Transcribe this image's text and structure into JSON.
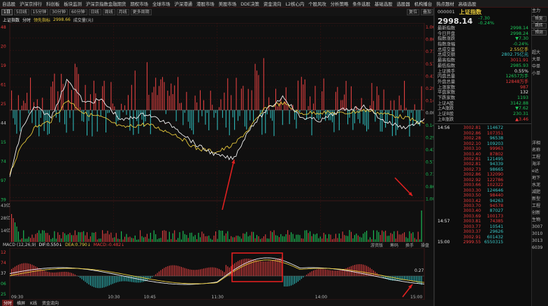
{
  "topnav": [
    "自选股",
    "沪深京排行",
    "科创板",
    "板块监测",
    "沪深京指数金融期货",
    "期权市场",
    "全球市场",
    "沪深港通",
    "港股市场",
    "美股市场",
    "DDE决策",
    "资金流向",
    "L2核心内",
    "个股风攻",
    "分析策略",
    "条件选股",
    "基础选股",
    "选股器",
    "机构播台",
    "热点题材",
    "高级选股"
  ],
  "toolbar": {
    "periods": [
      "1日",
      "5日线",
      "15分钟",
      "30分钟",
      "60分钟",
      "日线",
      "周线",
      "月线",
      "更多周期"
    ],
    "right": [
      "复位",
      "叠加"
    ]
  },
  "chartinfo": {
    "name": "上证指数",
    "period": "分时",
    "index_label": "领先指标",
    "index_value": "2998.66",
    "volume_label": "成交量(元)"
  },
  "left_axis": [
    "48",
    "20",
    "19",
    "61",
    "25",
    "44",
    "15",
    "74",
    "97",
    "39"
  ],
  "vol_axis": [
    "43亿",
    "28亿",
    "14亿"
  ],
  "macd_axis": [
    "12",
    "74",
    "37",
    "06",
    "25"
  ],
  "right_axis": [
    "1.06%",
    "0.86%",
    "0.71%",
    "0.57%",
    "0.43%",
    "0.29%",
    "0.14%",
    "0.00%",
    "0.14%",
    "0.29%",
    "0.43%",
    "0.57%",
    "0.71%",
    "0.86%",
    "1.00%"
  ],
  "macd": {
    "label": "MACD (12,26,9)",
    "dif": "DIF:0.550↓",
    "dea": "DEA:0.790↓",
    "macd": "MACD:-0.482↓",
    "tabs": [
      "游资版",
      "筹码",
      "换手",
      "操盘"
    ],
    "axis_value": "0.27"
  },
  "time_labels": [
    "09:30",
    "10:30",
    "10:45",
    "11:30",
    "14:00",
    "15:00"
  ],
  "bottombar": [
    "分时",
    "横屏",
    "K线",
    "资金流向"
  ],
  "quote": {
    "code": "000001",
    "name": "上证指数",
    "price": "2998.14",
    "change": "-7.30",
    "change_pct": "-0.24%",
    "rows": [
      {
        "k": "最新指数",
        "v": "2998.14",
        "c": "green"
      },
      {
        "k": "今日开盘",
        "v": "2998.24",
        "c": "green"
      },
      {
        "k": "指数涨跌",
        "v": "▼7.30",
        "c": "green"
      },
      {
        "k": "指数涨幅",
        "v": "-0.24%",
        "c": "green"
      },
      {
        "k": "总成交量",
        "v": "2.55亿手",
        "c": "yellow"
      },
      {
        "k": "总成交额",
        "v": "2802.75亿元",
        "c": "cyan"
      },
      {
        "k": "最高指数",
        "v": "3011.91",
        "c": "red"
      },
      {
        "k": "最低指数",
        "v": "2985.93",
        "c": "green"
      },
      {
        "k": "上证换手",
        "v": "0.55%",
        "c": "white"
      },
      {
        "k": "内盘总量",
        "v": "12657万手",
        "c": "green"
      },
      {
        "k": "外盘总量",
        "v": "12848万手",
        "c": "red"
      },
      {
        "k": "上涨家数",
        "v": "987",
        "c": "red"
      },
      {
        "k": "平盘家数",
        "v": "132",
        "c": "white"
      },
      {
        "k": "下跌家数",
        "v": "1193",
        "c": "green"
      },
      {
        "k": "上证A股",
        "v": "3142.88",
        "c": "green"
      },
      {
        "k": "上A涨跌",
        "v": "▼7.62",
        "c": "green"
      },
      {
        "k": "上证B股",
        "v": "230.31",
        "c": "green"
      },
      {
        "k": "上B涨跌",
        "v": "▲3.46",
        "c": "red"
      }
    ],
    "ticks": [
      {
        "t": "14:56",
        "p": "3002.81",
        "v": "114672",
        "d": "cyan"
      },
      {
        "t": "",
        "p": "3002.86",
        "v": "107351",
        "d": "red"
      },
      {
        "t": "",
        "p": "3002.28",
        "v": "96538",
        "d": "cyan"
      },
      {
        "t": "",
        "p": "3002.10",
        "v": "109203",
        "d": "cyan"
      },
      {
        "t": "",
        "p": "3003.10",
        "v": "99963",
        "d": "red"
      },
      {
        "t": "",
        "p": "3003.40",
        "v": "87802",
        "d": "red"
      },
      {
        "t": "",
        "p": "3002.81",
        "v": "121495",
        "d": "cyan"
      },
      {
        "t": "",
        "p": "3002.81",
        "v": "94339",
        "d": "cyan"
      },
      {
        "t": "",
        "p": "3002.73",
        "v": "98665",
        "d": "cyan"
      },
      {
        "t": "",
        "p": "3002.86",
        "v": "132090",
        "d": "red"
      },
      {
        "t": "",
        "p": "3002.92",
        "v": "122786",
        "d": "red"
      },
      {
        "t": "",
        "p": "3003.66",
        "v": "102322",
        "d": "red"
      },
      {
        "t": "",
        "p": "3003.30",
        "v": "124646",
        "d": "cyan"
      },
      {
        "t": "",
        "p": "3003.50",
        "v": "98440",
        "d": "red"
      },
      {
        "t": "",
        "p": "3003.42",
        "v": "94263",
        "d": "cyan"
      },
      {
        "t": "",
        "p": "3003.70",
        "v": "94578",
        "d": "red"
      },
      {
        "t": "",
        "p": "3003.40",
        "v": "87027",
        "d": "cyan"
      },
      {
        "t": "",
        "p": "3003.69",
        "v": "100173",
        "d": "red"
      },
      {
        "t": "14:57",
        "p": "3003.81",
        "v": "74385",
        "d": "red"
      },
      {
        "t": "",
        "p": "3003.77",
        "v": "10541",
        "d": "cyan"
      },
      {
        "t": "",
        "p": "3003.37",
        "v": "29626",
        "d": "cyan"
      },
      {
        "t": "",
        "p": "3002.91",
        "v": "601432",
        "d": "cyan"
      },
      {
        "t": "15:00",
        "p": "2999.55",
        "v": "6550315",
        "d": "cyan"
      }
    ]
  },
  "sidebtn": [
    "恢复",
    "跳转",
    "预测"
  ],
  "farright": [
    "主力",
    "主力",
    "主力",
    "主力",
    "",
    "",
    "超大",
    "大单",
    "中单",
    "小单",
    "",
    "",
    "",
    "",
    "",
    "",
    "",
    "",
    "",
    "洋相",
    "名称",
    "工程",
    "海洋",
    "e达",
    "地下",
    "水泥",
    "减肥",
    "新型",
    "工程",
    "创新",
    "生物",
    "3007",
    "3010",
    "3013",
    "6039"
  ],
  "colors": {
    "up": "#f03c3c",
    "down": "#1ec85a",
    "price": "#f0f0f0",
    "avg": "#e7c93c",
    "macd_red": "#e04040",
    "macd_cyan": "#2eb7b7",
    "grid": "#3a1212",
    "highlight": "#e02020"
  }
}
